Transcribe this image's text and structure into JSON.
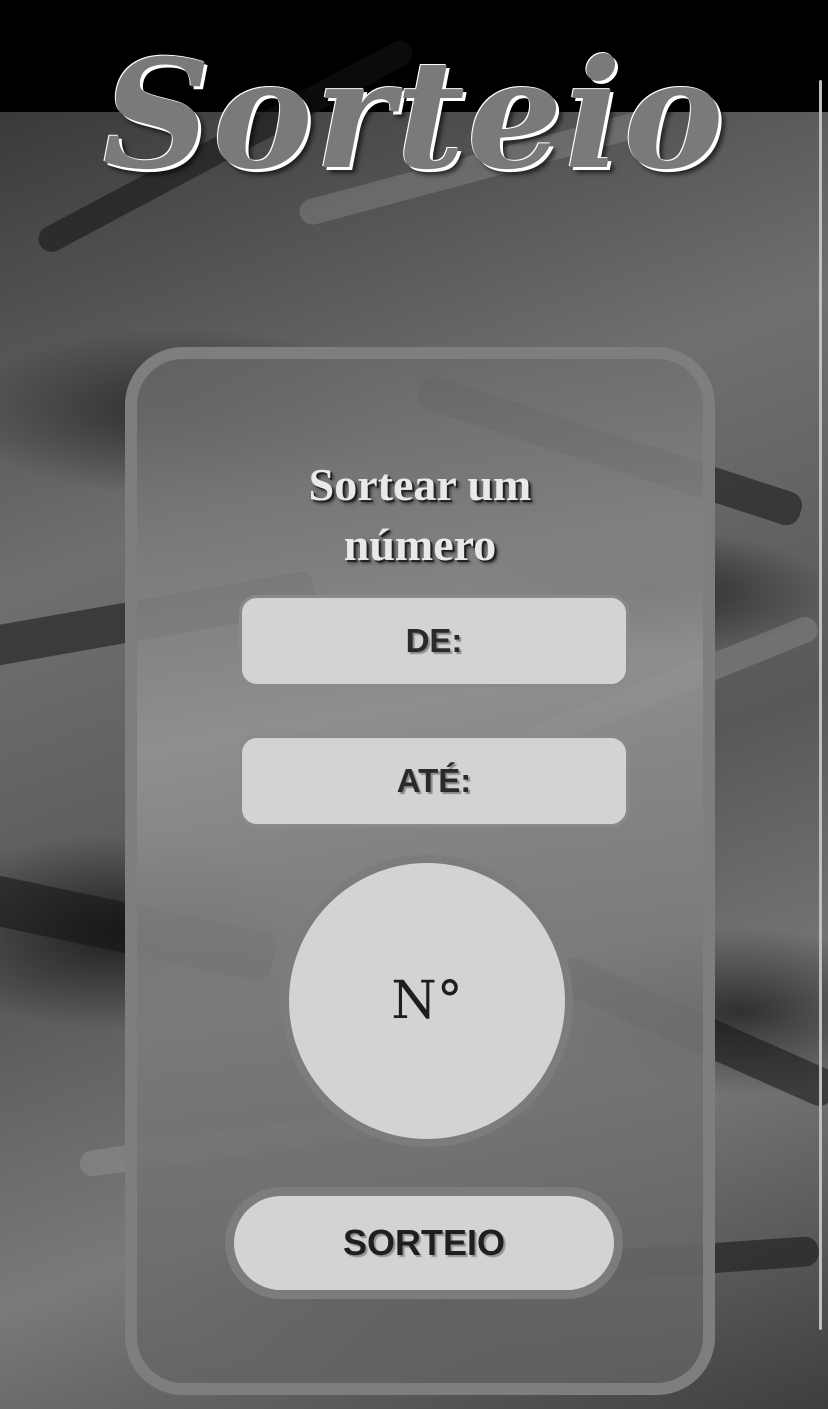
{
  "header": {
    "title": "Sorteio"
  },
  "card": {
    "heading_line1": "Sortear um",
    "heading_line2": "número",
    "from_label": "DE:",
    "to_label": "ATÉ:",
    "result_placeholder": "N°",
    "draw_button_label": "SORTEIO"
  },
  "colors": {
    "background": "#000000",
    "card_border": "#7e7e7e",
    "field_fill": "#d3d3d3",
    "title_fill": "#7a7a7a"
  }
}
